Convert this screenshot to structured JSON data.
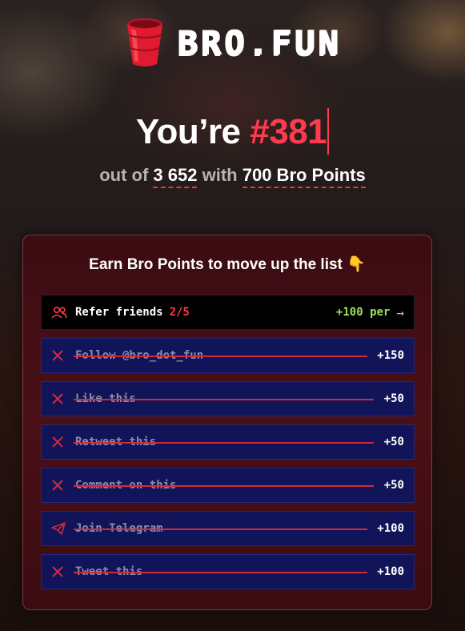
{
  "brand": {
    "name": "BRO.FUN"
  },
  "rank": {
    "prefix": "You’re",
    "position": "#381"
  },
  "summary": {
    "out_of_label": "out of",
    "total": "3 652",
    "with_label": "with",
    "points": "700 Bro Points"
  },
  "panel": {
    "title": "Earn Bro Points to move up the list 👇",
    "refer": {
      "label": "Refer friends",
      "count": "2/5",
      "reward": "+100 per"
    },
    "tasks": [
      {
        "label": "Follow @bro_dot_fun",
        "points": "+150",
        "icon": "x-icon"
      },
      {
        "label": "Like this",
        "points": "+50",
        "icon": "x-icon"
      },
      {
        "label": "Retweet this",
        "points": "+50",
        "icon": "x-icon"
      },
      {
        "label": "Comment on this",
        "points": "+50",
        "icon": "x-icon"
      },
      {
        "label": "Join Telegram",
        "points": "+100",
        "icon": "telegram-icon"
      },
      {
        "label": "Tweet this",
        "points": "+100",
        "icon": "x-icon"
      }
    ]
  },
  "colors": {
    "accent": "#ff3b4e",
    "done_bg": "#111458",
    "green": "#9ee35a"
  }
}
